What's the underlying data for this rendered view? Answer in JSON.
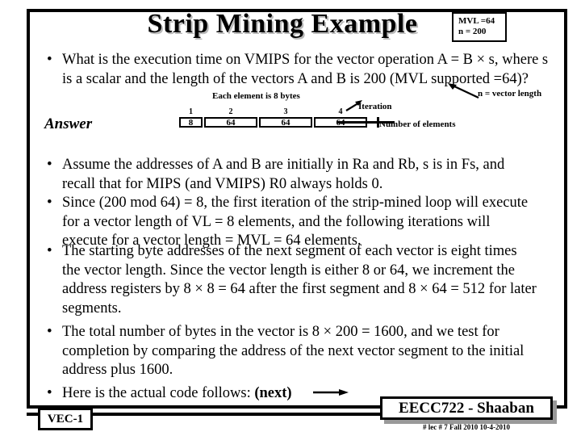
{
  "slide": {
    "title": "Strip Mining Example",
    "info_box": {
      "line1": "MVL =64",
      "line2": "n = 200"
    },
    "answer_label": "Answer",
    "bullet_mark": "•",
    "bullets": [
      "What is the execution time on VMIPS for the vector operation A = B × s, where s is a scalar and the length of the vectors A and B is 200 (MVL supported =64)?",
      "Assume the addresses of A and B are initially in Ra and Rb, s is in Fs, and recall that for MIPS (and VMIPS) R0 always holds 0.",
      "Since (200 mod 64) = 8, the first iteration of the strip-mined loop will execute for a vector length of VL = 8 elements, and the following iterations will execute for a vector length = MVL = 64 elements.",
      "The starting byte addresses of the next segment of each vector is eight times the vector length. Since the vector length is either 8 or 64, we increment the address registers by 8 × 8 = 64 after the first segment and 8 × 64 = 512 for later segments.",
      "The total number of bytes in the vector is 8 × 200 = 1600, and we test for completion by comparing the address of the next vector segment to the initial address plus 1600.",
      "Here is the actual code follows: "
    ],
    "next_label": "(next)",
    "annotations": {
      "each_element": "Each element is 8 bytes",
      "iteration": "Iteration",
      "vector_length": "n = vector length",
      "number_of_elements": "Number of elements"
    },
    "diagram": {
      "indices": [
        "1",
        "2",
        "3",
        "4"
      ],
      "values": [
        "8",
        "64",
        "64",
        "64"
      ]
    },
    "footer": {
      "left_badge": "VEC-1",
      "right_badge": "EECC722 - Shaaban",
      "sub_line": "#  lec # 7    Fall 2010   10-4-2010"
    },
    "colors": {
      "text": "#000000",
      "background": "#ffffff",
      "title_shadow": "#b8b8b8",
      "badge_shadow": "#999999"
    }
  }
}
